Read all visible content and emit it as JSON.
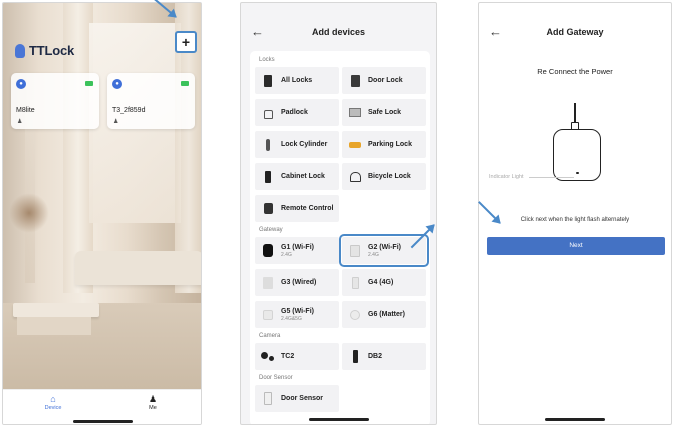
{
  "screen1": {
    "brand": "TTLock",
    "add_button": "+",
    "locks": [
      {
        "name": "M8lite",
        "user_icon": "person-icon"
      },
      {
        "name": "T3_2f859d",
        "user_icon": "person-icon"
      }
    ],
    "tabs": [
      {
        "label": "Device",
        "icon": "home-icon"
      },
      {
        "label": "Me",
        "icon": "person-icon"
      }
    ],
    "accent": "#3f6fd8"
  },
  "screen2": {
    "back": "←",
    "title": "Add devices",
    "sections": {
      "locks": "Locks",
      "gateway": "Gateway",
      "camera": "Camera",
      "door_sensor": "Door Sensor"
    },
    "locks": [
      "All Locks",
      "Door Lock",
      "Padlock",
      "Safe Lock",
      "Lock Cylinder",
      "Parking Lock",
      "Cabinet Lock",
      "Bicycle Lock",
      "Remote Control"
    ],
    "gateways": [
      {
        "label": "G1 (Wi-Fi)",
        "sub": "2.4G"
      },
      {
        "label": "G2 (Wi-Fi)",
        "sub": "2.4G"
      },
      {
        "label": "G3 (Wired)",
        "sub": ""
      },
      {
        "label": "G4 (4G)",
        "sub": ""
      },
      {
        "label": "G5 (Wi-Fi)",
        "sub": "2.4G&5G"
      },
      {
        "label": "G6 (Matter)",
        "sub": ""
      }
    ],
    "cameras": [
      "TC2",
      "DB2"
    ],
    "door_sensors": [
      "Door Sensor"
    ],
    "highlight_color": "#4a89c8"
  },
  "screen3": {
    "back": "←",
    "title": "Add Gateway",
    "subtitle": "Re Connect the Power",
    "indicator_label": "Indicator Light",
    "instruction": "Click next when the light flash alternately",
    "next_button": "Next",
    "button_color": "#4472c4"
  }
}
